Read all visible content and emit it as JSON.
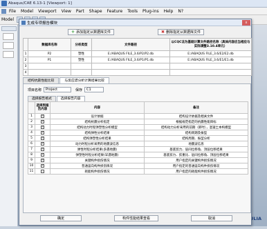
{
  "window": {
    "title": "Abaqus/CAE 6.13-1 [Viewport: 1]"
  },
  "menubar": {
    "items": [
      "File",
      "Model",
      "Viewport",
      "View",
      "Part",
      "Shape",
      "Feature",
      "Tools",
      "Plug-ins",
      "Help",
      "N?"
    ]
  },
  "toolbar": {
    "model_label": "Model"
  },
  "dialog": {
    "title": "生成专项报告模块",
    "close_label": "x",
    "add_button": "添加指定从数据库文件",
    "delete_button": "删除指定从数据库文件",
    "model_table": {
      "headers": [
        "",
        "数据库名称",
        "分析类型",
        "文件路径",
        "以CQC法为基础计算文件路径名称（具体内容应当相应与实际调整3.10.4单元）"
      ],
      "rows": [
        [
          "1",
          "P2",
          "塑性",
          "E:/ABAQUS FILE_3.6/P2/P2.db",
          "E:/ABAQUS FILE_3.6/E2/E2.db"
        ],
        [
          "2",
          "P1",
          "塑性",
          "E:/ABAQUS FILE_3.6/P1/P1.db",
          "E:/ABAQUS FILE_3.6/E1/E1.db"
        ],
        [
          "3",
          "",
          "",
          "",
          ""
        ],
        [
          "4",
          "",
          "",
          "",
          ""
        ]
      ]
    },
    "outer_tabs": [
      "结构抗震性能比较",
      "与反应谱分析计算结果比较"
    ],
    "project_label": "项目名称",
    "project_value": "Project",
    "save_label": "保存",
    "save_value": "C1",
    "inner_tabs": [
      "选择报告格式",
      "选择报告内容"
    ],
    "content_table": {
      "headers": [
        "",
        "选择到报告内容",
        "内容",
        "备注"
      ],
      "rows": [
        {
          "idx": "1",
          "checked": true,
          "content": "设计依据",
          "note": "结构设计依据及相关文件"
        },
        {
          "idx": "2",
          "checked": true,
          "content": "结构抗震分析指定",
          "note": "根据规范指定的抗震性能目标"
        },
        {
          "idx": "3",
          "checked": true,
          "content": "结构动力时程弹塑性分析模型",
          "note": "结构动力分析采用的前期（即时），混凝土本构模型"
        },
        {
          "idx": "4",
          "checked": true,
          "content": "结构弹性分析结果",
          "note": "结构周期及振型"
        },
        {
          "idx": "5",
          "checked": true,
          "content": "结构弹塑性分析结果",
          "note": "结构周期、振型分析"
        },
        {
          "idx": "6",
          "checked": true,
          "content": "动力时程分析采用的地震波信息",
          "note": "地震波信息"
        },
        {
          "idx": "7",
          "checked": true,
          "content": "弹性时程分析结果(多遇地震)",
          "note": "基底剪力、层间位移角、顶层位移结果"
        },
        {
          "idx": "8",
          "checked": true,
          "content": "弹塑性时程分析结果(罕遇地震)",
          "note": "基底剪力、剪重比、层间位移角、顶层位移结果"
        },
        {
          "idx": "9",
          "checked": true,
          "content": "关键构件损伤情况",
          "note": "用户指定的关键构件损伤情况"
        },
        {
          "idx": "10",
          "checked": true,
          "content": "普通竖向构件损伤情况",
          "note": "用户指定的普通竖向构件损伤情况"
        },
        {
          "idx": "11",
          "checked": false,
          "content": "耗能构件损伤情况",
          "note": "用户指定的耗能构件损伤情况"
        }
      ]
    },
    "ok_button": "确定",
    "mid_button": "构件性能结果查看",
    "cancel_button": "取消"
  },
  "logo": {
    "text": "SIMULIA"
  }
}
